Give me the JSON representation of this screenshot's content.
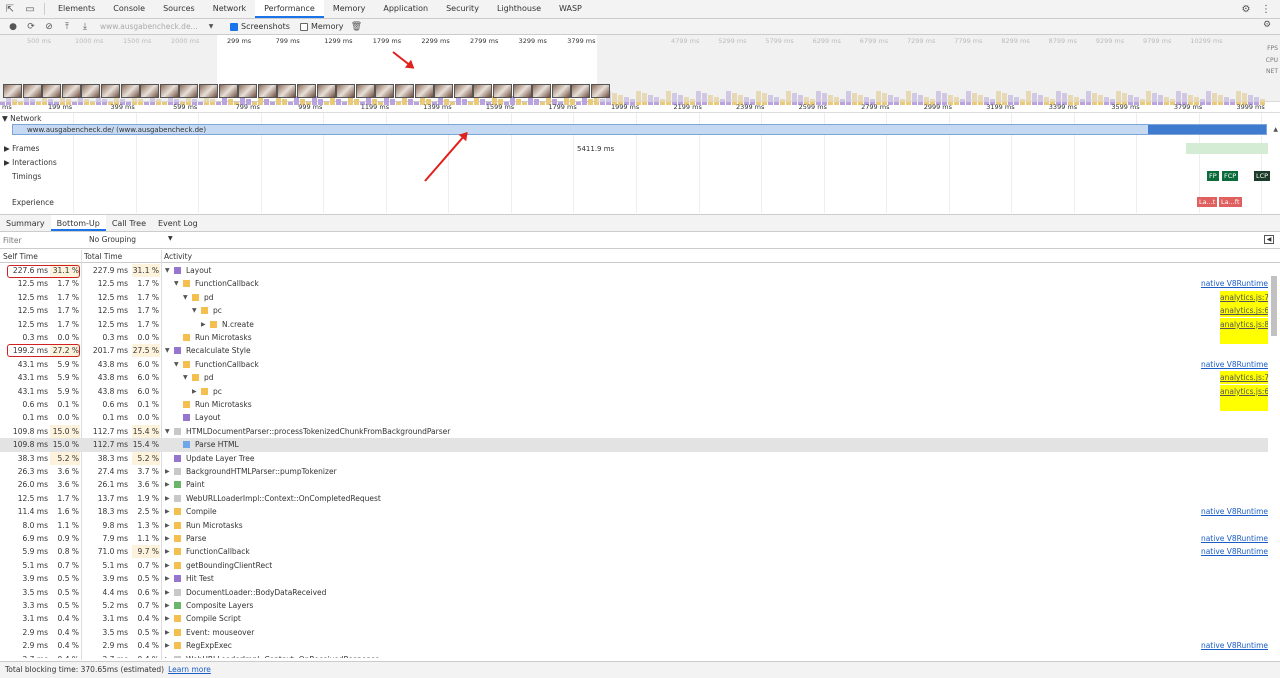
{
  "tabs": [
    "Elements",
    "Console",
    "Sources",
    "Network",
    "Performance",
    "Memory",
    "Application",
    "Security",
    "Lighthouse",
    "WASP"
  ],
  "active_tab": "Performance",
  "toolbar": {
    "url_select": "www.ausgabencheck.de...",
    "screenshots_label": "Screenshots",
    "memory_label": "Memory"
  },
  "overview_ticks_dim": [
    "500 ms",
    "1000 ms",
    "1500 ms",
    "2000 ms"
  ],
  "overview_ticks": [
    "299 ms",
    "799 ms",
    "1299 ms",
    "1799 ms",
    "2299 ms",
    "2799 ms",
    "3299 ms",
    "3799 ms"
  ],
  "overview_ticks_right": [
    "4799 ms",
    "5299 ms",
    "5799 ms",
    "6299 ms",
    "6799 ms",
    "7299 ms",
    "7799 ms",
    "8299 ms",
    "8799 ms",
    "9299 ms",
    "9799 ms",
    "10299 ms"
  ],
  "overview_labels": {
    "fps": "FPS",
    "cpu": "CPU",
    "net": "NET"
  },
  "ruler_ticks": [
    "ms",
    "199 ms",
    "399 ms",
    "599 ms",
    "799 ms",
    "999 ms",
    "1199 ms",
    "1399 ms",
    "1599 ms",
    "1799 ms",
    "1999 ms",
    "2199 ms",
    "2399 ms",
    "2599 ms",
    "2799 ms",
    "2999 ms",
    "3199 ms",
    "3399 ms",
    "3599 ms",
    "3799 ms",
    "3999 ms"
  ],
  "network": {
    "label": "Network",
    "url": "www.ausgabencheck.de/ (www.ausgabencheck.de)"
  },
  "tracks": {
    "frames": "Frames",
    "frames_value": "5411.9 ms",
    "interactions": "Interactions",
    "timings": "Timings",
    "experience": "Experience",
    "fp": "FP",
    "fcp": "FCP",
    "lcp": "LCP",
    "ls1": "La...t",
    "ls2": "La...ft"
  },
  "bottom_tabs": [
    "Summary",
    "Bottom-Up",
    "Call Tree",
    "Event Log"
  ],
  "active_bottom_tab": "Bottom-Up",
  "filter_placeholder": "Filter",
  "grouping": "No Grouping",
  "columns": {
    "self": "Self Time",
    "total": "Total Time",
    "activity": "Activity"
  },
  "colors": {
    "purple": "#9575cd",
    "yellow": "#f3c04f",
    "blue": "#6ea8e8",
    "green": "#6bb56b",
    "gray": "#c8c8c8"
  },
  "rows": [
    {
      "self": "227.6 ms",
      "sp": "31.1 %",
      "total": "227.9 ms",
      "tp": "31.1 %",
      "name": "Layout",
      "d": 0,
      "open": true,
      "c": "purple",
      "hs": true,
      "ht": true
    },
    {
      "self": "12.5 ms",
      "sp": "1.7 %",
      "total": "12.5 ms",
      "tp": "1.7 %",
      "name": "FunctionCallback",
      "d": 1,
      "open": true,
      "c": "yellow",
      "link": "native V8Runtime"
    },
    {
      "self": "12.5 ms",
      "sp": "1.7 %",
      "total": "12.5 ms",
      "tp": "1.7 %",
      "name": "pd",
      "d": 2,
      "open": true,
      "c": "yellow",
      "link": "analytics.js:77",
      "yl": true
    },
    {
      "self": "12.5 ms",
      "sp": "1.7 %",
      "total": "12.5 ms",
      "tp": "1.7 %",
      "name": "pc",
      "d": 3,
      "open": true,
      "c": "yellow",
      "link": "analytics.js:69",
      "yl": true
    },
    {
      "self": "12.5 ms",
      "sp": "1.7 %",
      "total": "12.5 ms",
      "tp": "1.7 %",
      "name": "N.create",
      "d": 4,
      "open": false,
      "c": "yellow",
      "link": "analytics.js:85",
      "yl": true
    },
    {
      "self": "0.3 ms",
      "sp": "0.0 %",
      "total": "0.3 ms",
      "tp": "0.0 %",
      "name": "Run Microtasks",
      "d": 1,
      "c": "yellow",
      "yfill": true
    },
    {
      "self": "199.2 ms",
      "sp": "27.2 %",
      "total": "201.7 ms",
      "tp": "27.5 %",
      "name": "Recalculate Style",
      "d": 0,
      "open": true,
      "c": "purple",
      "hs": true,
      "ht": true
    },
    {
      "self": "43.1 ms",
      "sp": "5.9 %",
      "total": "43.8 ms",
      "tp": "6.0 %",
      "name": "FunctionCallback",
      "d": 1,
      "open": true,
      "c": "yellow",
      "link": "native V8Runtime"
    },
    {
      "self": "43.1 ms",
      "sp": "5.9 %",
      "total": "43.8 ms",
      "tp": "6.0 %",
      "name": "pd",
      "d": 2,
      "open": true,
      "c": "yellow",
      "link": "analytics.js:77",
      "yl": true
    },
    {
      "self": "43.1 ms",
      "sp": "5.9 %",
      "total": "43.8 ms",
      "tp": "6.0 %",
      "name": "pc",
      "d": 3,
      "open": false,
      "c": "yellow",
      "link": "analytics.js:69",
      "yl": true
    },
    {
      "self": "0.6 ms",
      "sp": "0.1 %",
      "total": "0.6 ms",
      "tp": "0.1 %",
      "name": "Run Microtasks",
      "d": 1,
      "c": "yellow",
      "yfill": true
    },
    {
      "self": "0.1 ms",
      "sp": "0.0 %",
      "total": "0.1 ms",
      "tp": "0.0 %",
      "name": "Layout",
      "d": 1,
      "c": "purple"
    },
    {
      "self": "109.8 ms",
      "sp": "15.0 %",
      "total": "112.7 ms",
      "tp": "15.4 %",
      "name": "HTMLDocumentParser::processTokenizedChunkFromBackgroundParser",
      "d": 0,
      "open": true,
      "c": "gray",
      "hs": true,
      "ht": true
    },
    {
      "self": "109.8 ms",
      "sp": "15.0 %",
      "total": "112.7 ms",
      "tp": "15.4 %",
      "name": "Parse HTML",
      "d": 1,
      "c": "blue",
      "sel": true
    },
    {
      "self": "38.3 ms",
      "sp": "5.2 %",
      "total": "38.3 ms",
      "tp": "5.2 %",
      "name": "Update Layer Tree",
      "d": 0,
      "c": "purple",
      "hs": true,
      "ht": true
    },
    {
      "self": "26.3 ms",
      "sp": "3.6 %",
      "total": "27.4 ms",
      "tp": "3.7 %",
      "name": "BackgroundHTMLParser::pumpTokenizer",
      "d": 0,
      "open": false,
      "c": "gray"
    },
    {
      "self": "26.0 ms",
      "sp": "3.6 %",
      "total": "26.1 ms",
      "tp": "3.6 %",
      "name": "Paint",
      "d": 0,
      "open": false,
      "c": "green"
    },
    {
      "self": "12.5 ms",
      "sp": "1.7 %",
      "total": "13.7 ms",
      "tp": "1.9 %",
      "name": "WebURLLoaderImpl::Context::OnCompletedRequest",
      "d": 0,
      "open": false,
      "c": "gray"
    },
    {
      "self": "11.4 ms",
      "sp": "1.6 %",
      "total": "18.3 ms",
      "tp": "2.5 %",
      "name": "Compile",
      "d": 0,
      "open": false,
      "c": "yellow",
      "link": "native V8Runtime"
    },
    {
      "self": "8.0 ms",
      "sp": "1.1 %",
      "total": "9.8 ms",
      "tp": "1.3 %",
      "name": "Run Microtasks",
      "d": 0,
      "open": false,
      "c": "yellow"
    },
    {
      "self": "6.9 ms",
      "sp": "0.9 %",
      "total": "7.9 ms",
      "tp": "1.1 %",
      "name": "Parse",
      "d": 0,
      "open": false,
      "c": "yellow",
      "link": "native V8Runtime"
    },
    {
      "self": "5.9 ms",
      "sp": "0.8 %",
      "total": "71.0 ms",
      "tp": "9.7 %",
      "name": "FunctionCallback",
      "d": 0,
      "open": false,
      "c": "yellow",
      "link": "native V8Runtime",
      "ht": true
    },
    {
      "self": "5.1 ms",
      "sp": "0.7 %",
      "total": "5.1 ms",
      "tp": "0.7 %",
      "name": "getBoundingClientRect",
      "d": 0,
      "open": false,
      "c": "yellow"
    },
    {
      "self": "3.9 ms",
      "sp": "0.5 %",
      "total": "3.9 ms",
      "tp": "0.5 %",
      "name": "Hit Test",
      "d": 0,
      "open": false,
      "c": "purple"
    },
    {
      "self": "3.5 ms",
      "sp": "0.5 %",
      "total": "4.4 ms",
      "tp": "0.6 %",
      "name": "DocumentLoader::BodyDataReceived",
      "d": 0,
      "open": false,
      "c": "gray"
    },
    {
      "self": "3.3 ms",
      "sp": "0.5 %",
      "total": "5.2 ms",
      "tp": "0.7 %",
      "name": "Composite Layers",
      "d": 0,
      "open": false,
      "c": "green"
    },
    {
      "self": "3.1 ms",
      "sp": "0.4 %",
      "total": "3.1 ms",
      "tp": "0.4 %",
      "name": "Compile Script",
      "d": 0,
      "open": false,
      "c": "yellow"
    },
    {
      "self": "2.9 ms",
      "sp": "0.4 %",
      "total": "3.5 ms",
      "tp": "0.5 %",
      "name": "Event: mouseover",
      "d": 0,
      "open": false,
      "c": "yellow"
    },
    {
      "self": "2.9 ms",
      "sp": "0.4 %",
      "total": "2.9 ms",
      "tp": "0.4 %",
      "name": "RegExpExec",
      "d": 0,
      "open": false,
      "c": "yellow",
      "link": "native V8Runtime"
    },
    {
      "self": "2.7 ms",
      "sp": "0.4 %",
      "total": "2.7 ms",
      "tp": "0.4 %",
      "name": "WebURLLoaderImpl::Context::OnReceivedResponse",
      "d": 0,
      "open": false,
      "c": "gray"
    }
  ],
  "status": {
    "text": "Total blocking time: 370.65ms (estimated)",
    "link": "Learn more"
  }
}
